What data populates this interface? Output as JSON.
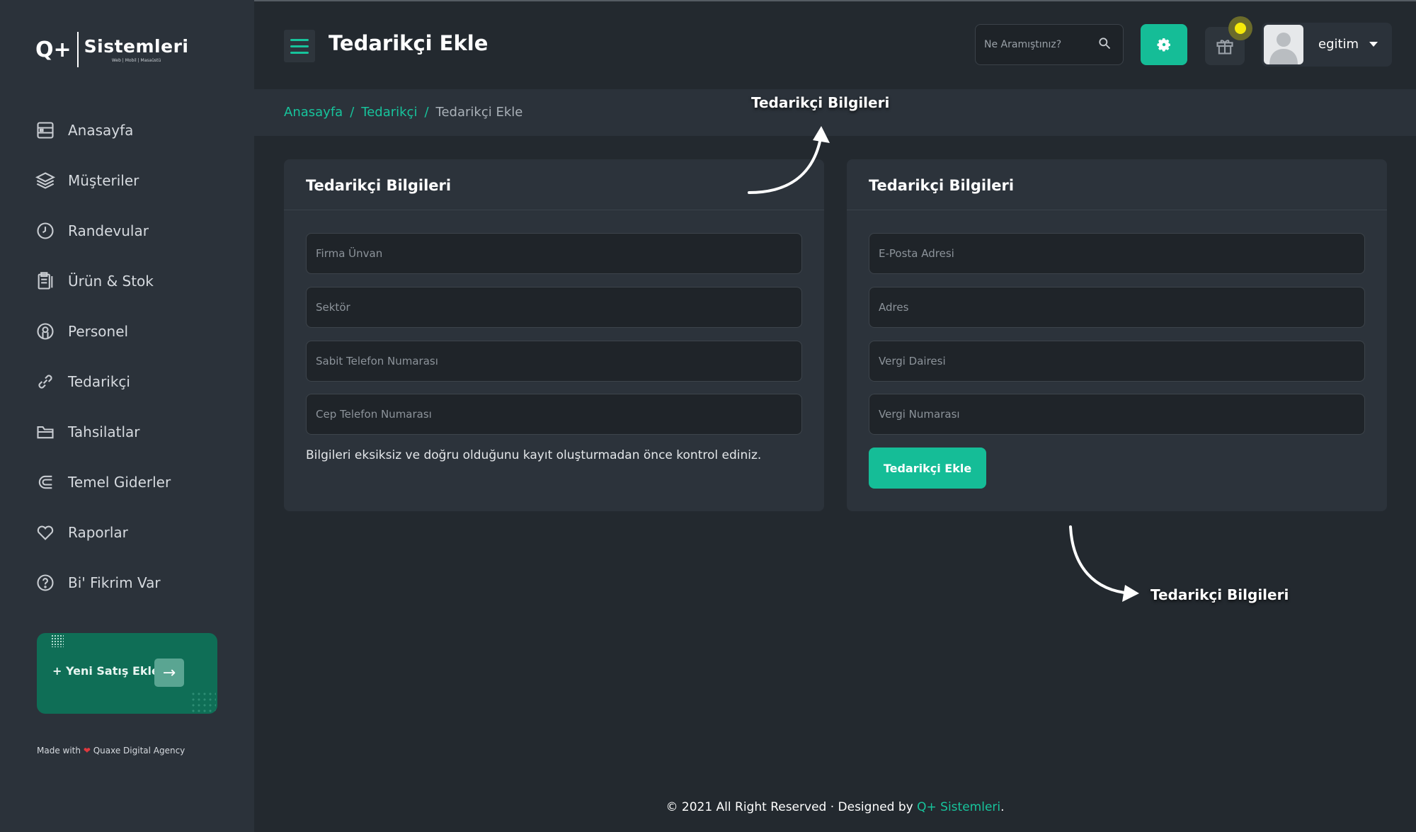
{
  "sidebar": {
    "logo": {
      "mark": "Q+",
      "name": "Sistemleri",
      "tagline": "Web | Mobil | Masaüstü"
    },
    "items": [
      {
        "label": "Anasayfa",
        "icon": "dashboard-icon"
      },
      {
        "label": "Müşteriler",
        "icon": "layers-icon"
      },
      {
        "label": "Randevular",
        "icon": "clock-icon"
      },
      {
        "label": "Ürün & Stok",
        "icon": "clipboard-icon"
      },
      {
        "label": "Personel",
        "icon": "user-circle-icon"
      },
      {
        "label": "Tedarikçi",
        "icon": "link-icon"
      },
      {
        "label": "Tahsilatlar",
        "icon": "folder-icon"
      },
      {
        "label": "Temel Giderler",
        "icon": "magnet-icon"
      },
      {
        "label": "Raporlar",
        "icon": "heart-icon"
      },
      {
        "label": "Bi' Fikrim Var",
        "icon": "help-circle-icon"
      }
    ],
    "sale_card": {
      "label": "+ Yeni Satış Ekle",
      "arrow": "→"
    },
    "made_with": {
      "prefix": "Made with",
      "heart": "❤",
      "agency": "Quaxe Digital Agency"
    }
  },
  "header": {
    "title": "Tedarikçi Ekle",
    "search_placeholder": "Ne Aramıştınız?",
    "username": "egitim"
  },
  "breadcrumb": {
    "home": "Anasayfa",
    "parent": "Tedarikçi",
    "current": "Tedarikçi Ekle",
    "separator": "/"
  },
  "left_card": {
    "title": "Tedarikçi Bilgileri",
    "fields": [
      {
        "placeholder": "Firma Ünvan"
      },
      {
        "placeholder": "Sektör"
      },
      {
        "placeholder": "Sabit Telefon Numarası"
      },
      {
        "placeholder": "Cep Telefon Numarası"
      }
    ],
    "note": "Bilgileri eksiksiz ve doğru olduğunu kayıt oluşturmadan önce kontrol ediniz."
  },
  "right_card": {
    "title": "Tedarikçi Bilgileri",
    "fields": [
      {
        "placeholder": "E-Posta Adresi"
      },
      {
        "placeholder": "Adres"
      },
      {
        "placeholder": "Vergi Dairesi"
      },
      {
        "placeholder": "Vergi Numarası"
      }
    ],
    "submit_label": "Tedarikçi Ekle"
  },
  "annotations": {
    "top": "Tedarikçi Bilgileri",
    "bottom": "Tedarikçi Bilgileri"
  },
  "footer": {
    "text": "© 2021 All Right Reserved · Designed by",
    "brand": "Q+ Sistemleri",
    "end": "."
  },
  "colors": {
    "accent": "#15bd97",
    "background": "#23292f",
    "sidebar": "#2b323a",
    "card": "#2c333b",
    "notification": "#f5e90a"
  }
}
